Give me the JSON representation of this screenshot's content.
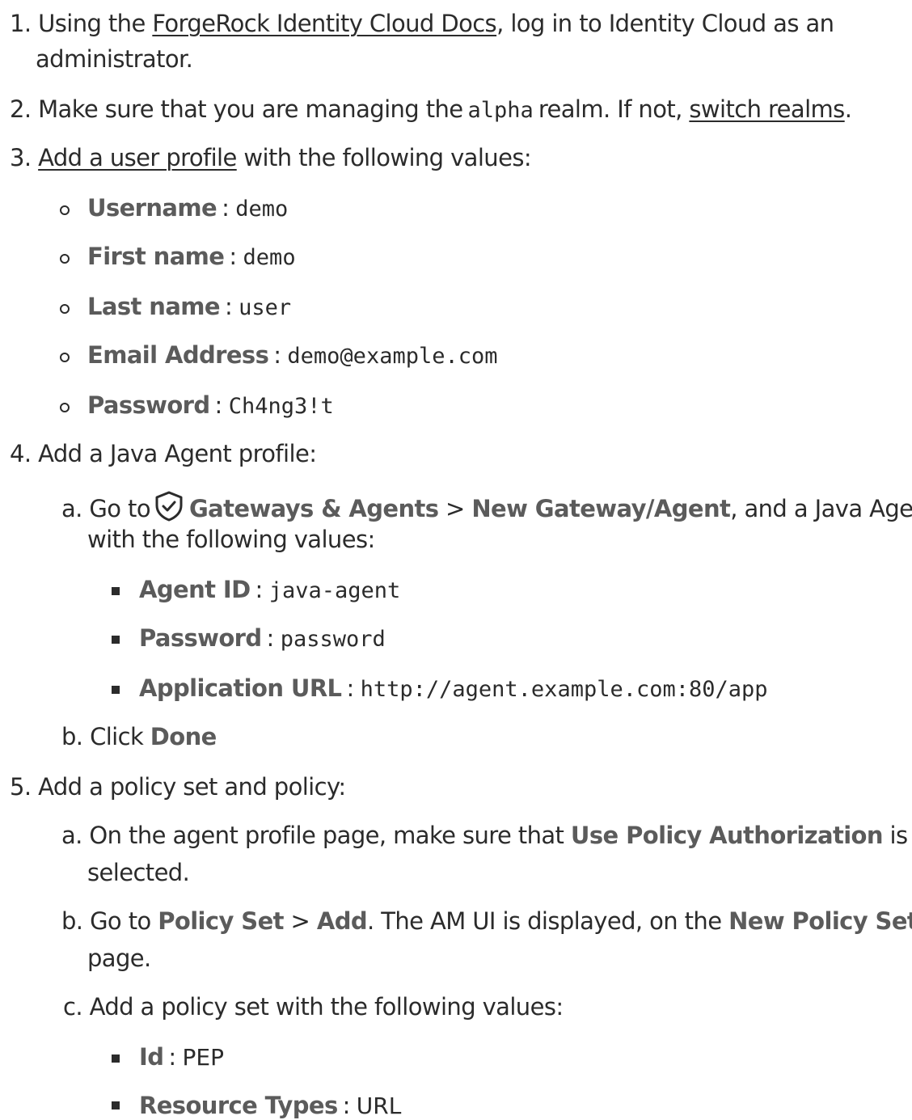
{
  "steps": {
    "s1": {
      "num": "1.",
      "pre": "Using the ",
      "link": "ForgeRock Identity Cloud Docs",
      "post": ", log in to Identity Cloud as an",
      "cont": "administrator."
    },
    "s2": {
      "num": "2.",
      "pre": "Make sure that you are managing the",
      "code": "alpha",
      "mid": "realm. If not, ",
      "link": "switch realms",
      "post": "."
    },
    "s3": {
      "num": "3.",
      "link": "Add a user profile",
      "post": " with the following values:",
      "fields": [
        {
          "label": "Username",
          "value": "demo"
        },
        {
          "label": "First name",
          "value": "demo"
        },
        {
          "label": "Last name",
          "value": "user"
        },
        {
          "label": "Email Address",
          "value": "demo@example.com"
        },
        {
          "label": "Password",
          "value": "Ch4ng3!t"
        }
      ]
    },
    "s4": {
      "num": "4.",
      "text": "Add a Java Agent profile:",
      "a": {
        "num": "a.",
        "pre": "Go to",
        "ui1": "Gateways & Agents",
        "sep": " > ",
        "ui2": "New Gateway/Agent",
        "post": ", and a Java Agent",
        "cont": "with the following values:",
        "fields": [
          {
            "label": "Agent ID",
            "value": "java-agent"
          },
          {
            "label": "Password",
            "value": "password"
          },
          {
            "label": "Application URL",
            "value": "http://agent.example.com:80/app"
          }
        ]
      },
      "b": {
        "num": "b.",
        "pre": "Click ",
        "ui": "Done"
      }
    },
    "s5": {
      "num": "5.",
      "text": "Add a policy set and policy:",
      "a": {
        "num": "a.",
        "pre": "On the agent profile page, make sure that ",
        "ui": "Use Policy Authorization",
        "post": " is",
        "cont": "selected."
      },
      "b": {
        "num": "b.",
        "pre": "Go to ",
        "ui1": "Policy Set",
        "sep": " > ",
        "ui2": "Add",
        "mid": ". The AM UI is displayed, on the ",
        "ui3": "New Policy Set",
        "cont": "page."
      },
      "c": {
        "num": "c.",
        "text": "Add a policy set with the following values:",
        "fields": [
          {
            "label": "Id",
            "value": "PEP"
          },
          {
            "label": "Resource Types",
            "value": "URL"
          }
        ]
      }
    }
  }
}
